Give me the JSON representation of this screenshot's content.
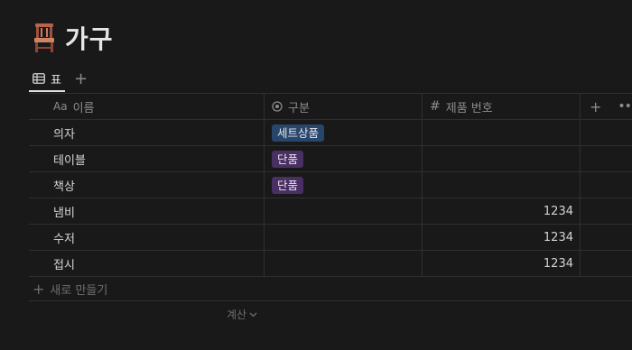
{
  "page": {
    "icon": "chair-icon",
    "title": "가구"
  },
  "view_tabs": {
    "active_label": "표",
    "active_icon": "table-icon",
    "add_icon": "plus-icon"
  },
  "table": {
    "columns": [
      {
        "icon_text": "Aa",
        "label": "이름"
      },
      {
        "icon": "status-circle-icon",
        "label": "구분"
      },
      {
        "icon_text": "#",
        "label": "제품 번호"
      }
    ],
    "rows": [
      {
        "name": "의자",
        "type": "세트상품",
        "type_color": "#28456c",
        "number": ""
      },
      {
        "name": "테이블",
        "type": "단품",
        "type_color": "#492f64",
        "number": ""
      },
      {
        "name": "책상",
        "type": "단품",
        "type_color": "#492f64",
        "number": ""
      },
      {
        "name": "냄비",
        "type": "",
        "type_color": "",
        "number": "1234"
      },
      {
        "name": "수저",
        "type": "",
        "type_color": "",
        "number": "1234"
      },
      {
        "name": "접시",
        "type": "",
        "type_color": "",
        "number": "1234"
      }
    ]
  },
  "new_row": {
    "label": "새로 만들기"
  },
  "calculate": {
    "label": "계산"
  }
}
